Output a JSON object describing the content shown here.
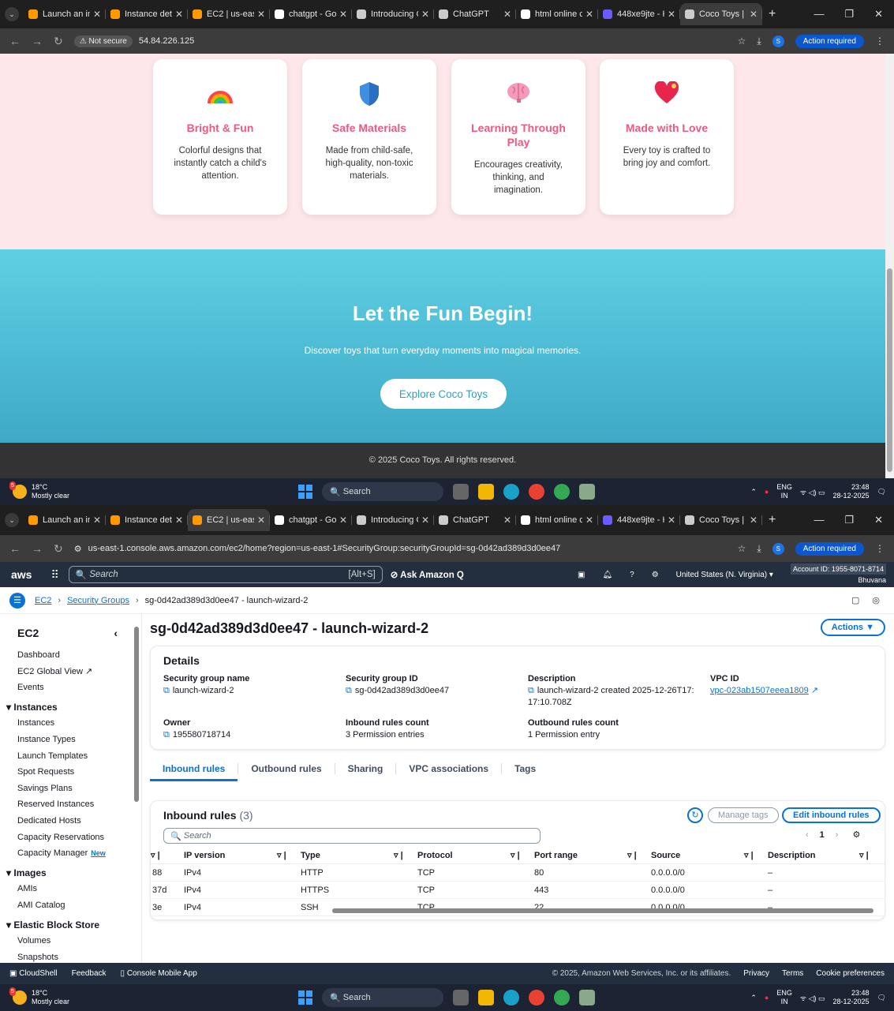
{
  "screen1": {
    "tabs": [
      {
        "title": "Launch an in",
        "color": "#ff9900"
      },
      {
        "title": "Instance deta",
        "color": "#ff9900"
      },
      {
        "title": "EC2 | us-east",
        "color": "#ff9900"
      },
      {
        "title": "chatgpt - Go",
        "color": "#ffffff"
      },
      {
        "title": "Introducing C",
        "color": "#cccccc"
      },
      {
        "title": "ChatGPT",
        "color": "#cccccc"
      },
      {
        "title": "html online c",
        "color": "#ffffff"
      },
      {
        "title": "448xe9jte - H",
        "color": "#6b5cff"
      },
      {
        "title": "Coco Toys | V",
        "color": "#cccccc",
        "active": true
      }
    ],
    "not_secure": "Not secure",
    "url": "54.84.226.125",
    "action_required": "Action required",
    "profile_initial": "S",
    "features": [
      {
        "icon": "rainbow-icon",
        "title": "Bright & Fun",
        "text": "Colorful designs that instantly catch a child's attention."
      },
      {
        "icon": "shield-icon",
        "title": "Safe Materials",
        "text": "Made from child-safe, high-quality, non-toxic materials."
      },
      {
        "icon": "brain-icon",
        "title": "Learning Through Play",
        "text": "Encourages creativity, thinking, and imagination."
      },
      {
        "icon": "heart-icon",
        "title": "Made with Love",
        "text": "Every toy is crafted to bring joy and comfort."
      }
    ],
    "cta_title": "Let the Fun Begin!",
    "cta_text": "Discover toys that turn everyday moments into magical memories.",
    "cta_button": "Explore Coco Toys",
    "footer": "© 2025 Coco Toys. All rights reserved."
  },
  "taskbar": {
    "temp": "18°C",
    "weather": "Mostly clear",
    "badge": "5",
    "search": "Search",
    "lang1": "ENG",
    "lang2": "IN",
    "time": "23:48",
    "date": "28-12-2025"
  },
  "screen2": {
    "tabs": [
      {
        "title": "Launch an in",
        "color": "#ff9900"
      },
      {
        "title": "Instance deta",
        "color": "#ff9900"
      },
      {
        "title": "EC2 | us-east",
        "color": "#ff9900",
        "active": true
      },
      {
        "title": "chatgpt - Go",
        "color": "#ffffff"
      },
      {
        "title": "Introducing C",
        "color": "#cccccc"
      },
      {
        "title": "ChatGPT",
        "color": "#cccccc"
      },
      {
        "title": "html online c",
        "color": "#ffffff"
      },
      {
        "title": "448xe9jte - H",
        "color": "#6b5cff"
      },
      {
        "title": "Coco Toys | V",
        "color": "#cccccc"
      }
    ],
    "url": "us-east-1.console.aws.amazon.com/ec2/home?region=us-east-1#SecurityGroup:securityGroupId=sg-0d42ad389d3d0ee47",
    "aws": {
      "logo": "aws",
      "search_placeholder": "Search",
      "shortcut": "[Alt+S]",
      "ask_q": "Ask Amazon Q",
      "region": "United States (N. Virginia)",
      "account": "Account ID: 1955-8071-8714",
      "user": "Bhuvana"
    },
    "breadcrumb": {
      "ec2": "EC2",
      "sg": "Security Groups",
      "current": "sg-0d42ad389d3d0ee47 - launch-wizard-2"
    },
    "sidebar": {
      "title": "EC2",
      "items": [
        {
          "label": "Dashboard"
        },
        {
          "label": "EC2 Global View ↗"
        },
        {
          "label": "Events"
        },
        {
          "label": "Instances",
          "section": true
        },
        {
          "label": "Instances"
        },
        {
          "label": "Instance Types"
        },
        {
          "label": "Launch Templates"
        },
        {
          "label": "Spot Requests"
        },
        {
          "label": "Savings Plans"
        },
        {
          "label": "Reserved Instances"
        },
        {
          "label": "Dedicated Hosts"
        },
        {
          "label": "Capacity Reservations"
        },
        {
          "label": "Capacity Manager",
          "badge": "New"
        },
        {
          "label": "Images",
          "section": true
        },
        {
          "label": "AMIs"
        },
        {
          "label": "AMI Catalog"
        },
        {
          "label": "Elastic Block Store",
          "section": true
        },
        {
          "label": "Volumes"
        },
        {
          "label": "Snapshots"
        }
      ]
    },
    "page_title": "sg-0d42ad389d3d0ee47 - launch-wizard-2",
    "actions": "Actions",
    "details": {
      "heading": "Details",
      "sg_name_label": "Security group name",
      "sg_name": "launch-wizard-2",
      "sg_id_label": "Security group ID",
      "sg_id": "sg-0d42ad389d3d0ee47",
      "desc_label": "Description",
      "desc": "launch-wizard-2 created 2025-12-26T17:17:10.708Z",
      "vpc_label": "VPC ID",
      "vpc": "vpc-023ab1507eeea1809",
      "owner_label": "Owner",
      "owner": "195580718714",
      "in_label": "Inbound rules count",
      "in_val": "3 Permission entries",
      "out_label": "Outbound rules count",
      "out_val": "1 Permission entry"
    },
    "tabs2": [
      "Inbound rules",
      "Outbound rules",
      "Sharing",
      "VPC associations",
      "Tags"
    ],
    "inbound": {
      "title": "Inbound rules",
      "count": "(3)",
      "manage_tags": "Manage tags",
      "edit": "Edit inbound rules",
      "search": "Search",
      "page": "1",
      "columns": [
        "IP version",
        "Type",
        "Protocol",
        "Port range",
        "Source",
        "Description"
      ],
      "rows": [
        {
          "id": "88",
          "ip": "IPv4",
          "type": "HTTP",
          "proto": "TCP",
          "port": "80",
          "source": "0.0.0.0/0",
          "desc": "–"
        },
        {
          "id": "37d",
          "ip": "IPv4",
          "type": "HTTPS",
          "proto": "TCP",
          "port": "443",
          "source": "0.0.0.0/0",
          "desc": "–"
        },
        {
          "id": "3e",
          "ip": "IPv4",
          "type": "SSH",
          "proto": "TCP",
          "port": "22",
          "source": "0.0.0.0/0",
          "desc": "–"
        }
      ]
    },
    "footer": {
      "cloudshell": "CloudShell",
      "feedback": "Feedback",
      "mobile": "Console Mobile App",
      "copyright": "© 2025, Amazon Web Services, Inc. or its affiliates.",
      "privacy": "Privacy",
      "terms": "Terms",
      "cookies": "Cookie preferences"
    }
  }
}
